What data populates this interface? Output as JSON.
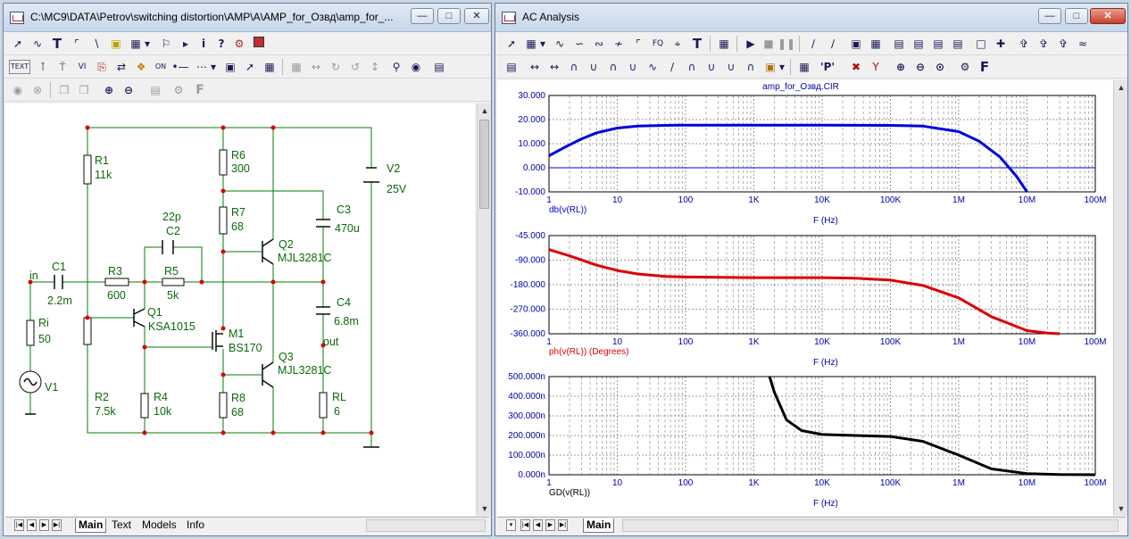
{
  "schematic_window": {
    "title": "C:\\MC9\\DATA\\Petrov\\switching distortion\\AMP\\A\\AMP_for_Озвд\\amp_for_...",
    "toolbar1": [
      "select-tool",
      "wire-tool",
      "text-tool",
      "line-tool",
      "diagonal-tool",
      "component-tool",
      "grid-tool",
      "flag-tool",
      "pin-tool",
      "info-tool",
      "help-tool",
      "probe-tool",
      "color-tool"
    ],
    "toolbar2_text_button": "TEXT",
    "tabs": [
      "Main",
      "Text",
      "Models",
      "Info"
    ],
    "active_tab": "Main",
    "components": {
      "input_label": "in",
      "C1_name": "C1",
      "C1_value": "2.2m",
      "R3_name": "R3",
      "R3_value": "600",
      "R5_name": "R5",
      "R5_value": "5k",
      "C2_name": "C2",
      "C2_value": "22p",
      "R1_name": "R1",
      "R1_value": "11k",
      "R2_name": "R2",
      "R2_value": "7.5k",
      "R4_name": "R4",
      "R4_value": "10k",
      "Ri_name": "Ri",
      "Ri_value": "50",
      "V1_name": "V1",
      "Q1_name": "Q1",
      "Q1_model": "KSA1015",
      "M1_name": "M1",
      "M1_model": "BS170",
      "R6_name": "R6",
      "R6_value": "300",
      "R7_name": "R7",
      "R7_value": "68",
      "R8_name": "R8",
      "R8_value": "68",
      "Q2_name": "Q2",
      "Q2_model": "MJL3281C",
      "Q3_name": "Q3",
      "Q3_model": "MJL3281C",
      "C3_name": "C3",
      "C3_value": "470u",
      "C4_name": "C4",
      "C4_value": "6.8m",
      "output_label": "out",
      "RL_name": "RL",
      "RL_value": "6",
      "V2_name": "V2",
      "V2_value": "25V"
    }
  },
  "ac_window": {
    "title": "AC Analysis",
    "text_button": "T",
    "p_button": "'P'",
    "tabs": [
      "Main"
    ],
    "active_tab": "Main",
    "circuit_name": "amp_for_Озвд.CIR",
    "colors": {
      "gain": "#0000dd",
      "phase": "#dd0000",
      "delay": "#000000",
      "axis_text": "#0000aa",
      "grid": "#7f7f7f"
    }
  },
  "chart_data": [
    {
      "type": "line",
      "title": "amp_for_Озвд.CIR",
      "xlabel": "F (Hz)",
      "ylabel": "db(v(RL))",
      "xscale": "log",
      "xlim": [
        1,
        100000000
      ],
      "ylim": [
        -10,
        30
      ],
      "x_ticks": [
        "1",
        "10",
        "100",
        "1K",
        "10K",
        "100K",
        "1M",
        "10M",
        "100M"
      ],
      "y_ticks": [
        "30.000",
        "20.000",
        "10.000",
        "0.000",
        "-10.000"
      ],
      "grid": true,
      "series": [
        {
          "name": "db(v(RL))",
          "color": "#0000dd",
          "x": [
            1,
            2,
            3,
            5,
            10,
            20,
            50,
            100,
            1000,
            10000,
            100000,
            300000,
            1000000,
            2000000,
            4000000,
            7000000,
            10000000
          ],
          "y": [
            5.0,
            9.5,
            12.0,
            14.5,
            16.5,
            17.3,
            17.6,
            17.7,
            17.7,
            17.7,
            17.6,
            17.3,
            15.0,
            11.0,
            4.5,
            -3.5,
            -10.0
          ]
        }
      ]
    },
    {
      "type": "line",
      "xlabel": "F (Hz)",
      "ylabel": "ph(v(RL)) (Degrees)",
      "xscale": "log",
      "xlim": [
        1,
        100000000
      ],
      "ylim": [
        -360,
        -45
      ],
      "x_ticks": [
        "1",
        "10",
        "100",
        "1K",
        "10K",
        "100K",
        "1M",
        "10M",
        "100M"
      ],
      "y_ticks": [
        "-45.000",
        "-90.000",
        "-180.000",
        "-270.000",
        "-360.000"
      ],
      "grid": true,
      "series": [
        {
          "name": "ph(v(RL)) (Degrees)",
          "color": "#dd0000",
          "x": [
            1,
            2,
            5,
            10,
            20,
            50,
            100,
            1000,
            10000,
            30000,
            100000,
            300000,
            1000000,
            3000000,
            10000000,
            20000000,
            30000000
          ],
          "y": [
            -90,
            -110,
            -140,
            -157,
            -168,
            -176,
            -178,
            -180,
            -180,
            -182,
            -188,
            -205,
            -245,
            -305,
            -350,
            -358,
            -360
          ]
        }
      ]
    },
    {
      "type": "line",
      "xlabel": "F (Hz)",
      "ylabel": "GD(v(RL))",
      "xscale": "log",
      "xlim": [
        1,
        100000000
      ],
      "ylim": [
        0,
        0.0005
      ],
      "x_ticks": [
        "1",
        "10",
        "100",
        "1K",
        "10K",
        "100K",
        "1M",
        "10M",
        "100M"
      ],
      "y_ticks": [
        "500.000n",
        "400.000n",
        "300.000n",
        "200.000n",
        "100.000n",
        "0.000n"
      ],
      "grid": true,
      "series": [
        {
          "name": "GD(v(RL))",
          "color": "#000000",
          "x": [
            1700,
            2000,
            3000,
            5000,
            10000,
            30000,
            100000,
            300000,
            1000000,
            3000000,
            10000000,
            30000000,
            100000000
          ],
          "y": [
            0.0005,
            0.00042,
            0.00028,
            0.000225,
            0.000205,
            0.0002,
            0.000195,
            0.00017,
            0.0001,
            3e-05,
            6e-06,
            1e-06,
            0.0
          ]
        }
      ]
    }
  ]
}
